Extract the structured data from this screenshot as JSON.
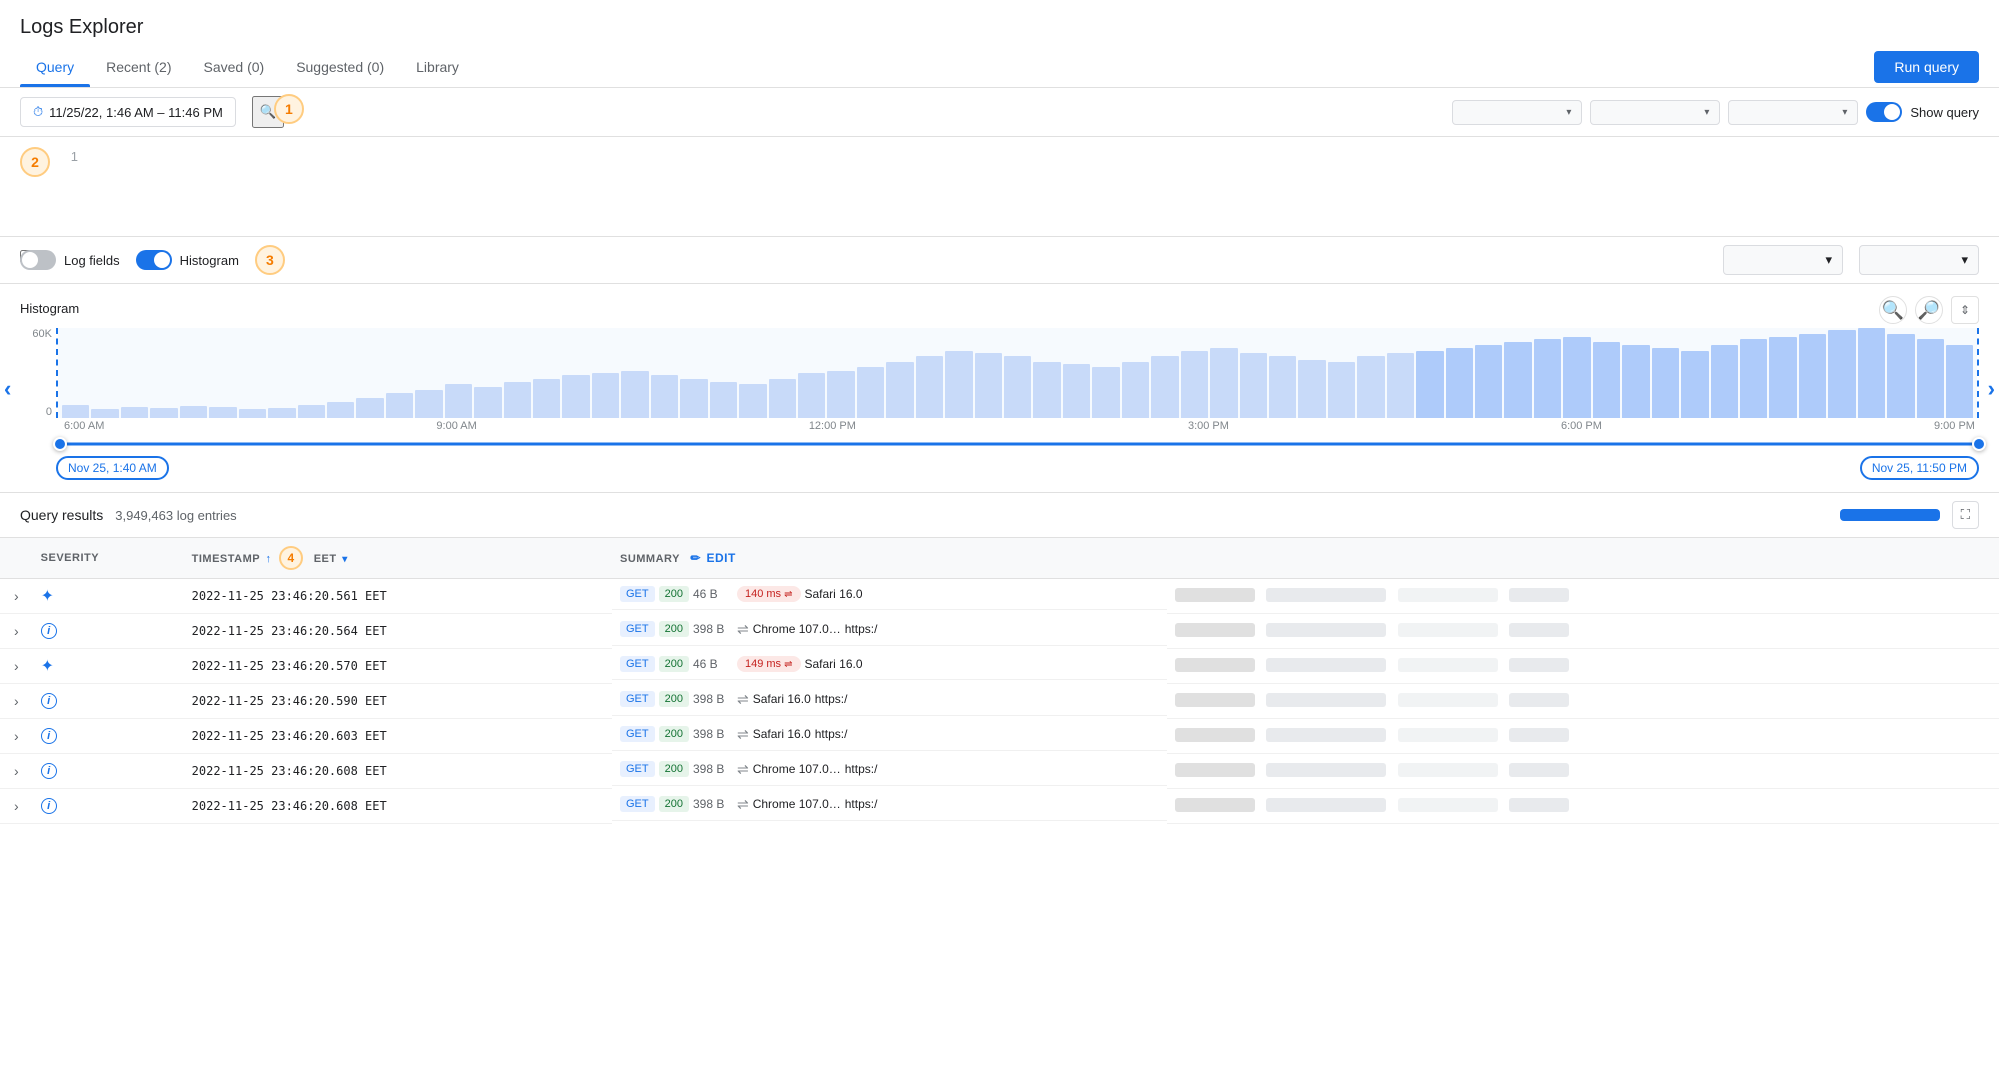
{
  "app": {
    "title": "Logs Explorer"
  },
  "tabs": [
    {
      "id": "query",
      "label": "Query",
      "active": true
    },
    {
      "id": "recent",
      "label": "Recent (2)",
      "active": false
    },
    {
      "id": "saved",
      "label": "Saved (0)",
      "active": false
    },
    {
      "id": "suggested",
      "label": "Suggested (0)",
      "active": false
    },
    {
      "id": "library",
      "label": "Library",
      "active": false
    }
  ],
  "toolbar": {
    "run_query_label": "Run query"
  },
  "query_bar": {
    "datetime_label": "11/25/22, 1:46 AM – 11:46 PM",
    "show_query_label": "Show query",
    "filter1_placeholder": "",
    "filter2_placeholder": "",
    "filter3_placeholder": ""
  },
  "editor": {
    "line_number": "1"
  },
  "controls": {
    "log_fields_label": "Log fields",
    "histogram_label": "Histogram"
  },
  "histogram": {
    "title": "Histogram",
    "y_max": "60K",
    "y_min": "0",
    "x_labels": [
      "6:00 AM",
      "9:00 AM",
      "12:00 PM",
      "3:00 PM",
      "6:00 PM",
      "9:00 PM"
    ],
    "range_start": "Nov 25, 1:40 AM",
    "range_end": "Nov 25, 11:50 PM",
    "bars": [
      12,
      8,
      10,
      9,
      11,
      10,
      8,
      9,
      12,
      14,
      18,
      22,
      25,
      30,
      28,
      32,
      35,
      38,
      40,
      42,
      38,
      35,
      32,
      30,
      35,
      40,
      42,
      45,
      50,
      55,
      60,
      58,
      55,
      50,
      48,
      45,
      50,
      55,
      60,
      62,
      58,
      55,
      52,
      50,
      55,
      58,
      60,
      62,
      65,
      68,
      70,
      72,
      68,
      65,
      62,
      60,
      65,
      70,
      72,
      75,
      78,
      80,
      75,
      70,
      65
    ]
  },
  "results": {
    "title": "Query results",
    "count": "3,949,463 log entries"
  },
  "table": {
    "columns": [
      "SEVERITY",
      "TIMESTAMP",
      "EET",
      "SUMMARY"
    ],
    "rows": [
      {
        "expand": ">",
        "severity_type": "star",
        "timestamp": "2022-11-25 23:46:20.561 EET",
        "method": "GET",
        "status": "200",
        "size": "46 B",
        "latency": "140 ms",
        "latency_high": true,
        "browser": "Safari 16.0",
        "extra": ""
      },
      {
        "expand": ">",
        "severity_type": "info",
        "timestamp": "2022-11-25 23:46:20.564 EET",
        "method": "GET",
        "status": "200",
        "size": "398 B",
        "latency": "",
        "latency_high": false,
        "browser": "Chrome 107.0…",
        "extra": "https:/"
      },
      {
        "expand": ">",
        "severity_type": "star",
        "timestamp": "2022-11-25 23:46:20.570 EET",
        "method": "GET",
        "status": "200",
        "size": "46 B",
        "latency": "149 ms",
        "latency_high": true,
        "browser": "Safari 16.0",
        "extra": ""
      },
      {
        "expand": ">",
        "severity_type": "info",
        "timestamp": "2022-11-25 23:46:20.590 EET",
        "method": "GET",
        "status": "200",
        "size": "398 B",
        "latency": "",
        "latency_high": false,
        "browser": "Safari 16.0",
        "extra": "https:/"
      },
      {
        "expand": ">",
        "severity_type": "info",
        "timestamp": "2022-11-25 23:46:20.603 EET",
        "method": "GET",
        "status": "200",
        "size": "398 B",
        "latency": "",
        "latency_high": false,
        "browser": "Safari 16.0",
        "extra": "https:/"
      },
      {
        "expand": ">",
        "severity_type": "info",
        "timestamp": "2022-11-25 23:46:20.608 EET",
        "method": "GET",
        "status": "200",
        "size": "398 B",
        "latency": "",
        "latency_high": false,
        "browser": "Chrome 107.0…",
        "extra": "https:/"
      },
      {
        "expand": ">",
        "severity_type": "info",
        "timestamp": "2022-11-25 23:46:20.608 EET",
        "method": "GET",
        "status": "200",
        "size": "398 B",
        "latency": "",
        "latency_high": false,
        "browser": "Chrome 107.0…",
        "extra": "https:/"
      }
    ]
  },
  "steps": {
    "step1": "1",
    "step2": "2",
    "step3": "3",
    "step4": "4"
  },
  "icons": {
    "clock": "⏰",
    "search": "🔍",
    "chevron_down": "▾",
    "zoom_out": "🔍",
    "edit": "✏",
    "expand": "⛶"
  }
}
